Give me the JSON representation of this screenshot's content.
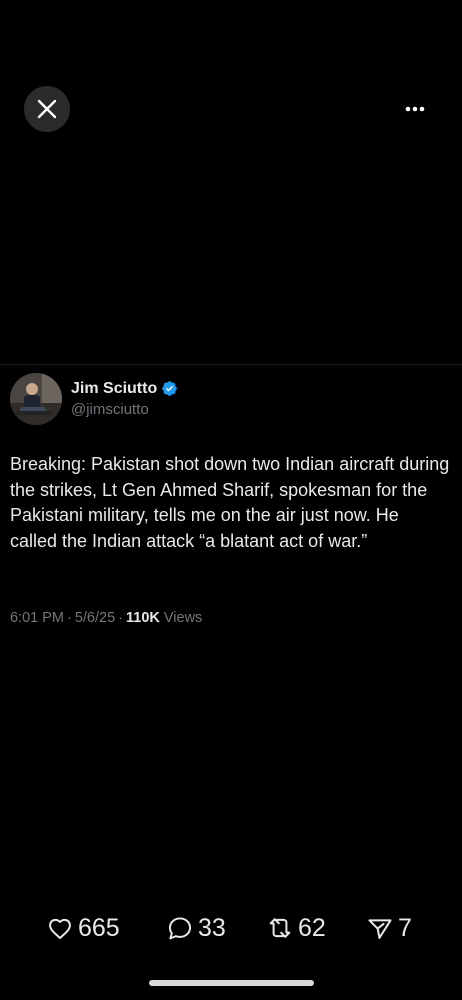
{
  "toolbar": {
    "close_icon": "close-icon",
    "more_icon": "more-horizontal-icon"
  },
  "author": {
    "display_name": "Jim Sciutto",
    "handle": "@jimsciutto",
    "verified": true,
    "verified_color": "#1d9bf0"
  },
  "tweet": {
    "text": "Breaking: Pakistan shot down two Indian aircraft during the strikes, Lt Gen Ahmed Sharif, spokesman for the Pakistani military, tells me on the air just now. He called the Indian attack “a blatant act of war.”"
  },
  "meta": {
    "time": "6:01 PM",
    "separator": "·",
    "date": "5/6/25",
    "views_count": "110K",
    "views_label": "Views"
  },
  "actions": {
    "likes": "665",
    "replies": "33",
    "reposts": "62",
    "shares": "7"
  },
  "colors": {
    "background": "#000000",
    "primary_text": "#e7e9ea",
    "secondary_text": "#71767b"
  }
}
